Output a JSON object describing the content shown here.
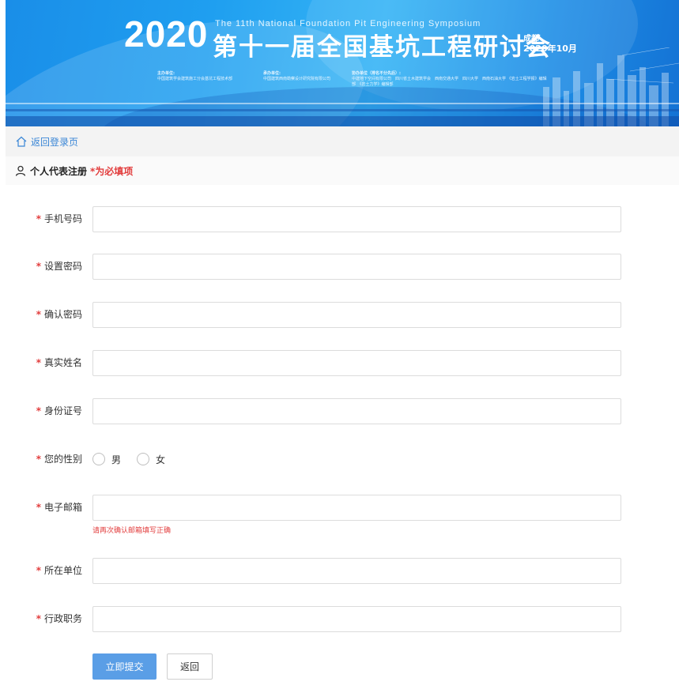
{
  "banner": {
    "year": "2020",
    "subtitle_en": "The 11th National Foundation Pit Engineering Symposium",
    "title_cn": "第十一届全国基坑工程研讨会",
    "city": "成都",
    "date": "2020年10月",
    "organizers": [
      {
        "head": "主办单位:",
        "body": "中国建筑学会建筑施工分会基坑工程技术部"
      },
      {
        "head": "承办单位:",
        "body": "中国建筑西南勘察设计研究院有限公司"
      },
      {
        "head": "协办单位（排名不分先后）:",
        "body": "中建地下空间有限公司　四川省土木建筑学会　西南交通大学　四川大学　西南石油大学 《岩土工程学报》编辑部　《岩土力学》编辑部"
      }
    ]
  },
  "nav": {
    "back_login": "返回登录页"
  },
  "section": {
    "title": "个人代表注册",
    "required_note": "*为必填项"
  },
  "form": {
    "required_mark": "*",
    "fields": [
      {
        "label": "手机号码",
        "value": ""
      },
      {
        "label": "设置密码",
        "value": ""
      },
      {
        "label": "确认密码",
        "value": ""
      },
      {
        "label": "真实姓名",
        "value": ""
      },
      {
        "label": "身份证号",
        "value": ""
      },
      {
        "label": "您的性别",
        "options": [
          "男",
          "女"
        ],
        "selected": null
      },
      {
        "label": "电子邮箱",
        "value": "",
        "hint": "请再次确认邮箱填写正确"
      },
      {
        "label": "所在单位",
        "value": ""
      },
      {
        "label": "行政职务",
        "value": ""
      }
    ]
  },
  "buttons": {
    "submit": "立即提交",
    "back": "返回"
  },
  "colors": {
    "accent": "#5a9ee6",
    "required": "#e23d3d",
    "link": "#3a86d6"
  }
}
